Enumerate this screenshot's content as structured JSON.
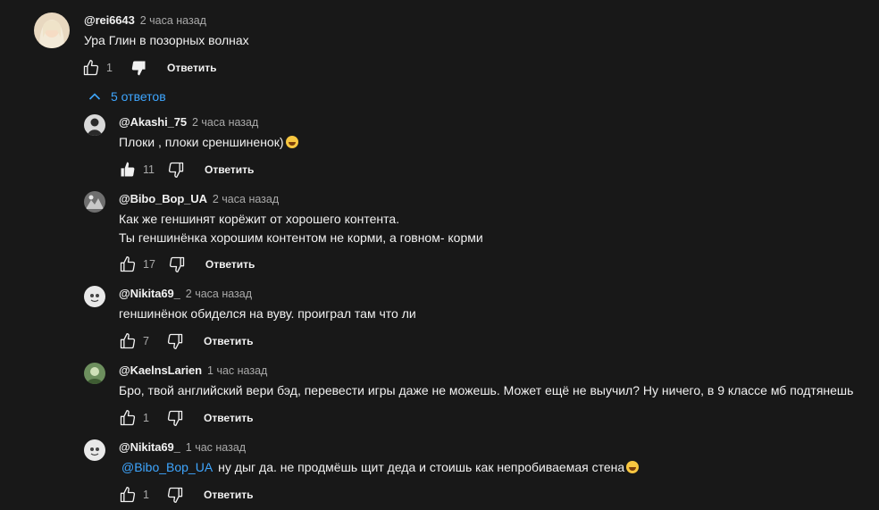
{
  "main_comment": {
    "author": "@rei6643",
    "time": "2 часа назад",
    "text": "Ура Глин в позорных волнах",
    "likes": "1",
    "reply_label": "Ответить"
  },
  "replies_toggle": {
    "label": "5 ответов"
  },
  "replies": [
    {
      "author": "@Akashi_75",
      "time": "2 часа назад",
      "line1": "Плоки , плоки среншиненок)",
      "likes": "11",
      "reply_label": "Ответить"
    },
    {
      "author": "@Bibo_Bop_UA",
      "time": "2 часа назад",
      "line1": "Как же геншинят корёжит от хорошего контента.",
      "line2": "Ты геншинёнка хорошим контентом не корми, а говном- корми",
      "likes": "17",
      "reply_label": "Ответить"
    },
    {
      "author": "@Nikita69_",
      "time": "2 часа назад",
      "line1": "геншинёнок обиделся на вуву. проиграл там что ли",
      "likes": "7",
      "reply_label": "Ответить"
    },
    {
      "author": "@KaelnsLarien",
      "time": "1 час назад",
      "line1": "Бро, твой английский вери бэд, перевести игры даже не можешь. Может ещё не выучил? Ну ничего, в 9 классе мб подтянешь",
      "likes": "1",
      "reply_label": "Ответить"
    },
    {
      "author": "@Nikita69_",
      "time": "1 час назад",
      "mention": "@Bibo_Bop_UA",
      "line1": "ну дыг да. не продмёшь щит деда и стоишь как  непробиваемая стена",
      "likes": "1",
      "reply_label": "Ответить"
    }
  ],
  "colors": {
    "background": "#181818",
    "text": "#f1f1f1",
    "secondary": "#aaaaaa",
    "link": "#3ea6ff"
  },
  "icons": [
    "thumb-up-icon",
    "thumb-up-filled-icon",
    "thumb-down-icon",
    "thumb-down-filled-icon",
    "chevron-up-icon",
    "laughing-emoji",
    "rofl-emoji"
  ]
}
